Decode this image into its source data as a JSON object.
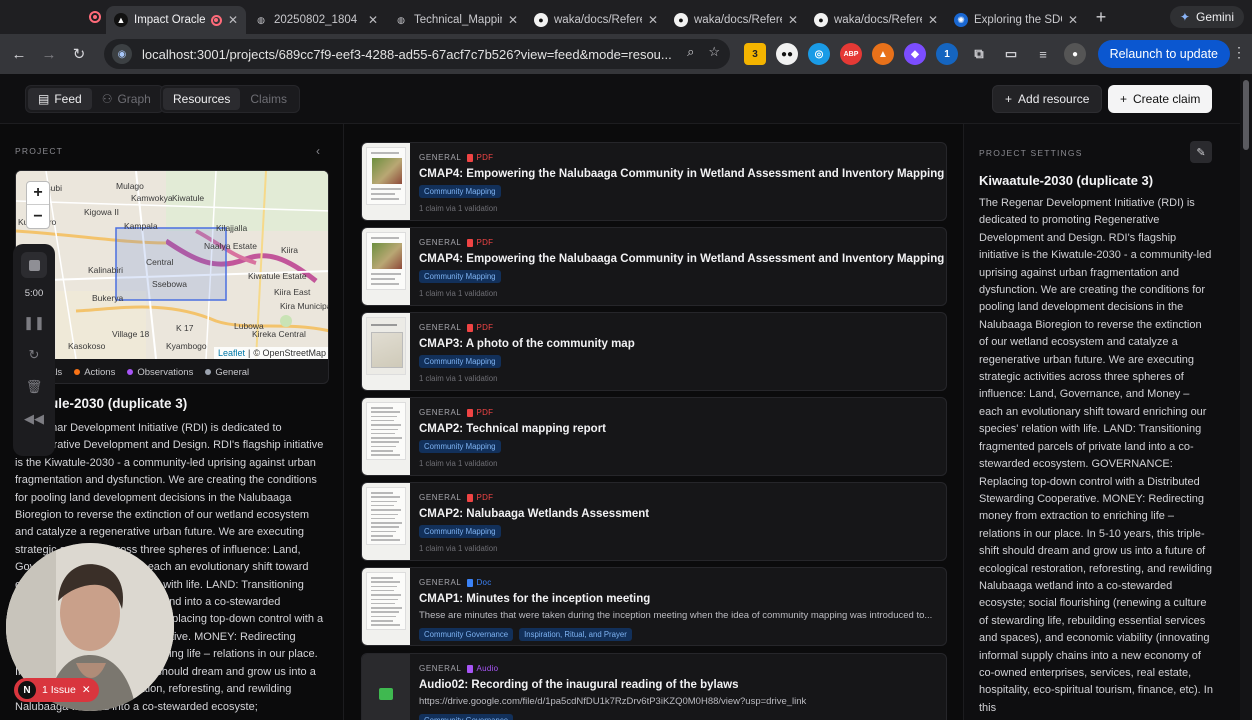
{
  "browser": {
    "tabs": [
      {
        "label": "Impact Oracle",
        "icon": "triangle-icon",
        "active": true
      },
      {
        "label": "20250802_1804",
        "icon": "globe-icon"
      },
      {
        "label": "Technical_Mapping",
        "icon": "globe-icon"
      },
      {
        "label": "waka/docs/Reference",
        "icon": "github-icon"
      },
      {
        "label": "waka/docs/Reference",
        "icon": "github-icon"
      },
      {
        "label": "waka/docs/Reference",
        "icon": "github-icon"
      },
      {
        "label": "Exploring the SDGs",
        "icon": "gear-icon"
      }
    ],
    "gemini_label": "Gemini",
    "url": "localhost:3001/projects/689cc7f9-eef3-4288-ad55-67acf7c7b526?view=feed&mode=resou...",
    "relaunch_label": "Relaunch to update",
    "ext_badges": {
      "first": "3",
      "second": "1"
    }
  },
  "appbar": {
    "view_tabs": [
      "Feed",
      "Graph"
    ],
    "mode_tabs": [
      "Resources",
      "Claims"
    ],
    "add_resource": "Add resource",
    "create_claim": "Create claim"
  },
  "left": {
    "section_label": "PROJECT",
    "map": {
      "zoom_in": "+",
      "zoom_out": "−",
      "places": [
        "Kasubi",
        "Mulago",
        "Central",
        "Kiwatule",
        "Kigowa II",
        "Kamwokya",
        "Naalya Estate",
        "Kulambiro",
        "Kampala",
        "Kilajjalla",
        "Kalinabiri",
        "Kiira",
        "Ssebowa",
        "Kiwatule Estate",
        "Bukerya",
        "Kiira East",
        "Kira Municipality",
        "Lubowa",
        "Village 18",
        "K 17",
        "Kireka Central",
        "Kasokoso",
        "Kyambogo"
      ],
      "attribution_leaflet": "Leaflet",
      "attribution_osm": "© OpenStreetMap"
    },
    "legend": [
      {
        "label": "osals",
        "color": "#3b82f6"
      },
      {
        "label": "Actions",
        "color": "#f97316"
      },
      {
        "label": "Observations",
        "color": "#a855f7"
      },
      {
        "label": "General",
        "color": "#9ca3af"
      }
    ],
    "title": "ule-2030 (duplicate 3)",
    "description": "enar Development Initiative (RDI) is dedicated to Regenerative Development and Design. RDI's flagship initiative is the Kiwatule-2030 - a community-led uprising against urban fragmentation and dysfunction. We are creating the conditions for pooling land development decisions in the Nalubaaga Bioregion to reverse the extinction of our wetland ecosystem and catalyze a regenerative urban future. We are executing strategic activities across three spheres of influence: Land, Governance, and Money – each an evolutionary shift toward enriching our species' relation with life. LAND: Transitioning fragmented parcels of private land into a co-stewarded ecosystem. GOVERNANCE: Replacing top-down control with a Distributed Stewarding Cooperative. MONEY: Redirecting money from extraction to enriching life – relations in our place. In 5-10 years, this triple-shift should dream and grow us into a future of ecological restoration, reforesting, and rewilding Nalubaaga wetland into a co-stewarded ecosyste;"
  },
  "recorder": {
    "time": "5:00"
  },
  "issue": {
    "count_letter": "N",
    "label": "1 Issue"
  },
  "feed": {
    "cards": [
      {
        "category": "GENERAL",
        "type": "PDF",
        "title": "CMAP4: Empowering the Nalubaaga Community in Wetland Assessment and Inventory Mapping",
        "tags": [
          "Community Mapping"
        ],
        "footer": "1 claim via 1 validation",
        "thumb": "photo"
      },
      {
        "category": "GENERAL",
        "type": "PDF",
        "title": "CMAP4: Empowering the Nalubaaga Community in Wetland Assessment and Inventory Mapping",
        "tags": [
          "Community Mapping"
        ],
        "footer": "1 claim via 1 validation",
        "thumb": "photo"
      },
      {
        "category": "GENERAL",
        "type": "PDF",
        "title": "CMAP3: A photo of the community map",
        "tags": [
          "Community Mapping"
        ],
        "footer": "1 claim via 1 validation",
        "thumb": "map"
      },
      {
        "category": "GENERAL",
        "type": "PDF",
        "title": "CMAP2: Technical mapping report",
        "tags": [
          "Community Mapping"
        ],
        "footer": "1 claim via 1 validation",
        "thumb": "text"
      },
      {
        "category": "GENERAL",
        "type": "PDF",
        "title": "CMAP2: Nalubaaga Wetlands Assessment",
        "tags": [
          "Community Mapping"
        ],
        "footer": "1 claim via 1 validation",
        "thumb": "text"
      },
      {
        "category": "GENERAL",
        "type": "Doc",
        "title": "CMAP1: Minutes for the inception meeting",
        "description": "These are minutes that were taken during the inception meeting when the idea of community mapping was introduced to...",
        "tags": [
          "Community Governance",
          "Inspiration, Ritual, and Prayer"
        ],
        "thumb": "text"
      },
      {
        "category": "GENERAL",
        "type": "Audio",
        "title": "Audio02: Recording of the inaugural reading of the bylaws",
        "description": "https://drive.google.com/file/d/1pa5cdNfDU1k7RzDrv6tP3iKZQ0M0H88/view?usp=drive_link",
        "tags": [
          "Community Governance"
        ],
        "thumb": "audio"
      }
    ]
  },
  "right": {
    "section_label": "PROJECT SETTINGS",
    "title": "Kiwaatule-2030 (duplicate 3)",
    "description": "The Regenar Development Initiative (RDI) is dedicated to promoting Regenerative Development and Design. RDI's flagship initiative is the Kiwatule-2030 - a community-led uprising against urban fragmentation and dysfunction. We are creating the conditions for pooling land development decisions in the Nalubaaga Bioregion to reverse the extinction of our wetland ecosystem and catalyze a regenerative urban future. We are executing strategic activities across three spheres of influence: Land, Governance, and Money – each an evolutionary shift toward enriching our species' relation with life. LAND: Transitioning fragmented parcels of private land into a co-stewarded ecosystem. GOVERNANCE: Replacing top-down control with a Distributed Stewarding Cooperative. MONEY: Redirecting money from extraction to enriching life – relations in our place. In 5-10 years, this triple-shift should dream and grow us into a future of ecological restoration, reforesting, and rewilding Nalubaaga wetland into a co-stewarded ecosyste; social flourishing (renewing a culture of stewarding life, rebuilding essential services and spaces), and economic viability (innovating informal supply chains into a new economy of co-owned enterprises, services, real estate, hospitality, eco-spiritual tourism, finance, etc). In this"
  },
  "colors": {
    "pdf": "#ef4444",
    "doc": "#3b82f6",
    "audio": "#a855f7",
    "accent": "#0b57d0"
  }
}
